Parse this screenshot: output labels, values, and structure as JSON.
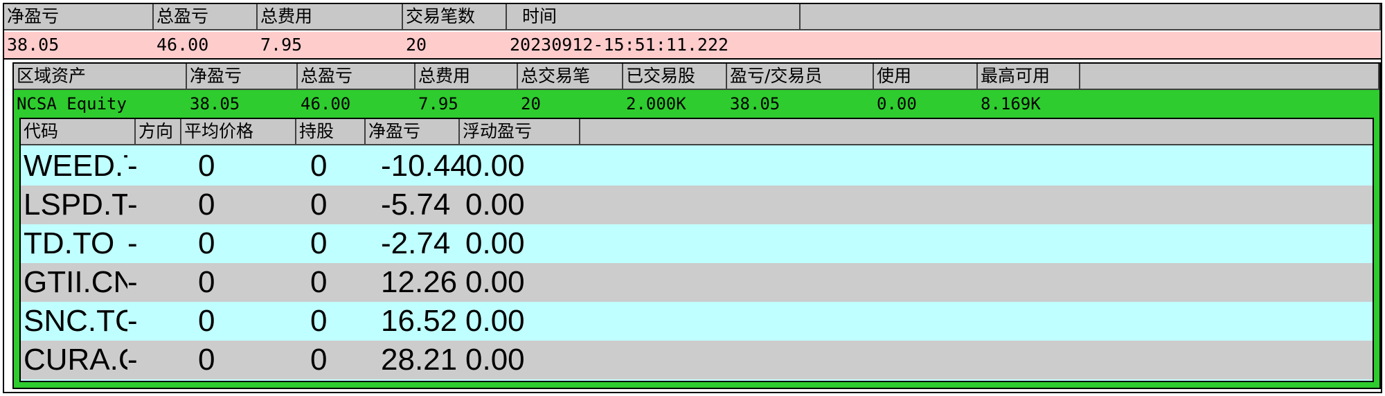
{
  "summary": {
    "headers": [
      "净盈亏",
      "总盈亏",
      "总费用",
      "交易笔数",
      "时间"
    ],
    "values": [
      "38.05",
      "46.00",
      "7.95",
      "20",
      "20230912-15:51:11.222"
    ]
  },
  "region": {
    "headers": [
      "区域资产",
      "净盈亏",
      "总盈亏",
      "总费用",
      "总交易笔",
      "已交易股",
      "盈亏/交易员",
      "使用",
      "最高可用"
    ],
    "values": [
      "NCSA Equity",
      "38.05",
      "46.00",
      "7.95",
      "20",
      "2.000K",
      "38.05",
      "0.00",
      "8.169K"
    ]
  },
  "positions": {
    "headers": [
      "代码",
      "方向",
      "平均价格",
      "持股",
      "净盈亏",
      "浮动盈亏"
    ],
    "rows": [
      {
        "code": "WEED.T",
        "direction": "-",
        "avg_price": "0",
        "shares": "0",
        "net_pnl": "-10.44",
        "float_pnl": "0.00"
      },
      {
        "code": "LSPD.T",
        "direction": "-",
        "avg_price": "0",
        "shares": "0",
        "net_pnl": "-5.74",
        "float_pnl": "0.00"
      },
      {
        "code": "TD.TO",
        "direction": "-",
        "avg_price": "0",
        "shares": "0",
        "net_pnl": "-2.74",
        "float_pnl": "0.00"
      },
      {
        "code": "GTII.CN",
        "direction": "-",
        "avg_price": "0",
        "shares": "0",
        "net_pnl": "12.26",
        "float_pnl": "0.00"
      },
      {
        "code": "SNC.TC",
        "direction": "-",
        "avg_price": "0",
        "shares": "0",
        "net_pnl": "16.52",
        "float_pnl": "0.00"
      },
      {
        "code": "CURA.C",
        "direction": "-",
        "avg_price": "0",
        "shares": "0",
        "net_pnl": "28.21",
        "float_pnl": "0.00"
      }
    ]
  },
  "colors": {
    "header_gray": "#c8c8c8",
    "summary_pink": "#ffcccc",
    "region_green": "#2ecc2e",
    "row_cyan": "#c0ffff",
    "row_gray": "#cccccc"
  }
}
